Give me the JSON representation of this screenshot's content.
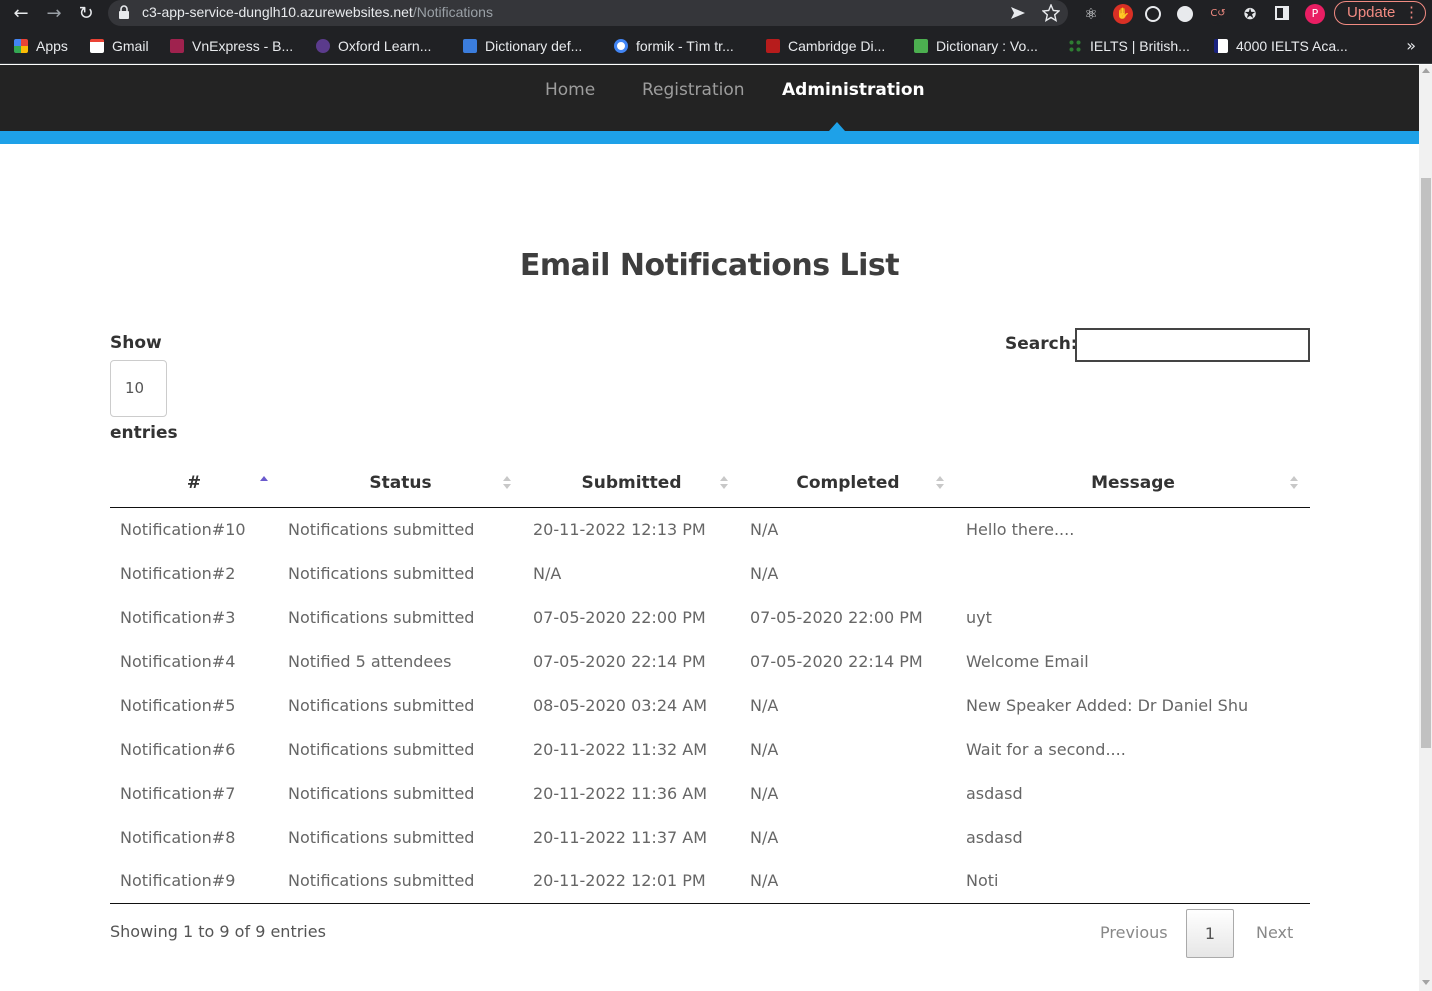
{
  "browser": {
    "url_host": "c3-app-service-dunglh10.azurewebsites.net",
    "url_path": "/Notifications",
    "update_label": "Update",
    "profile_initial": "P",
    "bookmarks": [
      "Apps",
      "Gmail",
      "VnExpress - B...",
      "Oxford Learn...",
      "Dictionary def...",
      "formik - Tìm tr...",
      "Cambridge Di...",
      "Dictionary : Vo...",
      "IELTS | British...",
      "4000 IELTS Aca..."
    ],
    "bookmarks_more": "»"
  },
  "nav": {
    "items": [
      "Home",
      "Registration",
      "Administration"
    ],
    "active": "Administration"
  },
  "page": {
    "title": "Email Notifications List",
    "show_label": "Show",
    "page_length": "10",
    "entries_label": "entries",
    "search_label": "Search:",
    "search_value": ""
  },
  "table": {
    "columns": [
      "#",
      "Status",
      "Submitted",
      "Completed",
      "Message"
    ],
    "sorted_column": "#",
    "rows": [
      [
        "Notification#10",
        "Notifications submitted",
        "20-11-2022 12:13 PM",
        "N/A",
        "Hello there...."
      ],
      [
        "Notification#2",
        "Notifications submitted",
        "N/A",
        "N/A",
        ""
      ],
      [
        "Notification#3",
        "Notifications submitted",
        "07-05-2020 22:00 PM",
        "07-05-2020 22:00 PM",
        "uyt"
      ],
      [
        "Notification#4",
        "Notified 5 attendees",
        "07-05-2020 22:14 PM",
        "07-05-2020 22:14 PM",
        "Welcome Email"
      ],
      [
        "Notification#5",
        "Notifications submitted",
        "08-05-2020 03:24 AM",
        "N/A",
        "New Speaker Added: Dr Daniel Shu"
      ],
      [
        "Notification#6",
        "Notifications submitted",
        "20-11-2022 11:32 AM",
        "N/A",
        "Wait for a second...."
      ],
      [
        "Notification#7",
        "Notifications submitted",
        "20-11-2022 11:36 AM",
        "N/A",
        "asdasd"
      ],
      [
        "Notification#8",
        "Notifications submitted",
        "20-11-2022 11:37 AM",
        "N/A",
        "asdasd"
      ],
      [
        "Notification#9",
        "Notifications submitted",
        "20-11-2022 12:01 PM",
        "N/A",
        "Noti"
      ]
    ]
  },
  "footer": {
    "info": "Showing 1 to 9 of 9 entries",
    "previous_label": "Previous",
    "current_page": "1",
    "next_label": "Next"
  },
  "colors": {
    "accent": "#1ea1e8",
    "nav_background": "#232323",
    "sort_active": "#6a5acd"
  }
}
